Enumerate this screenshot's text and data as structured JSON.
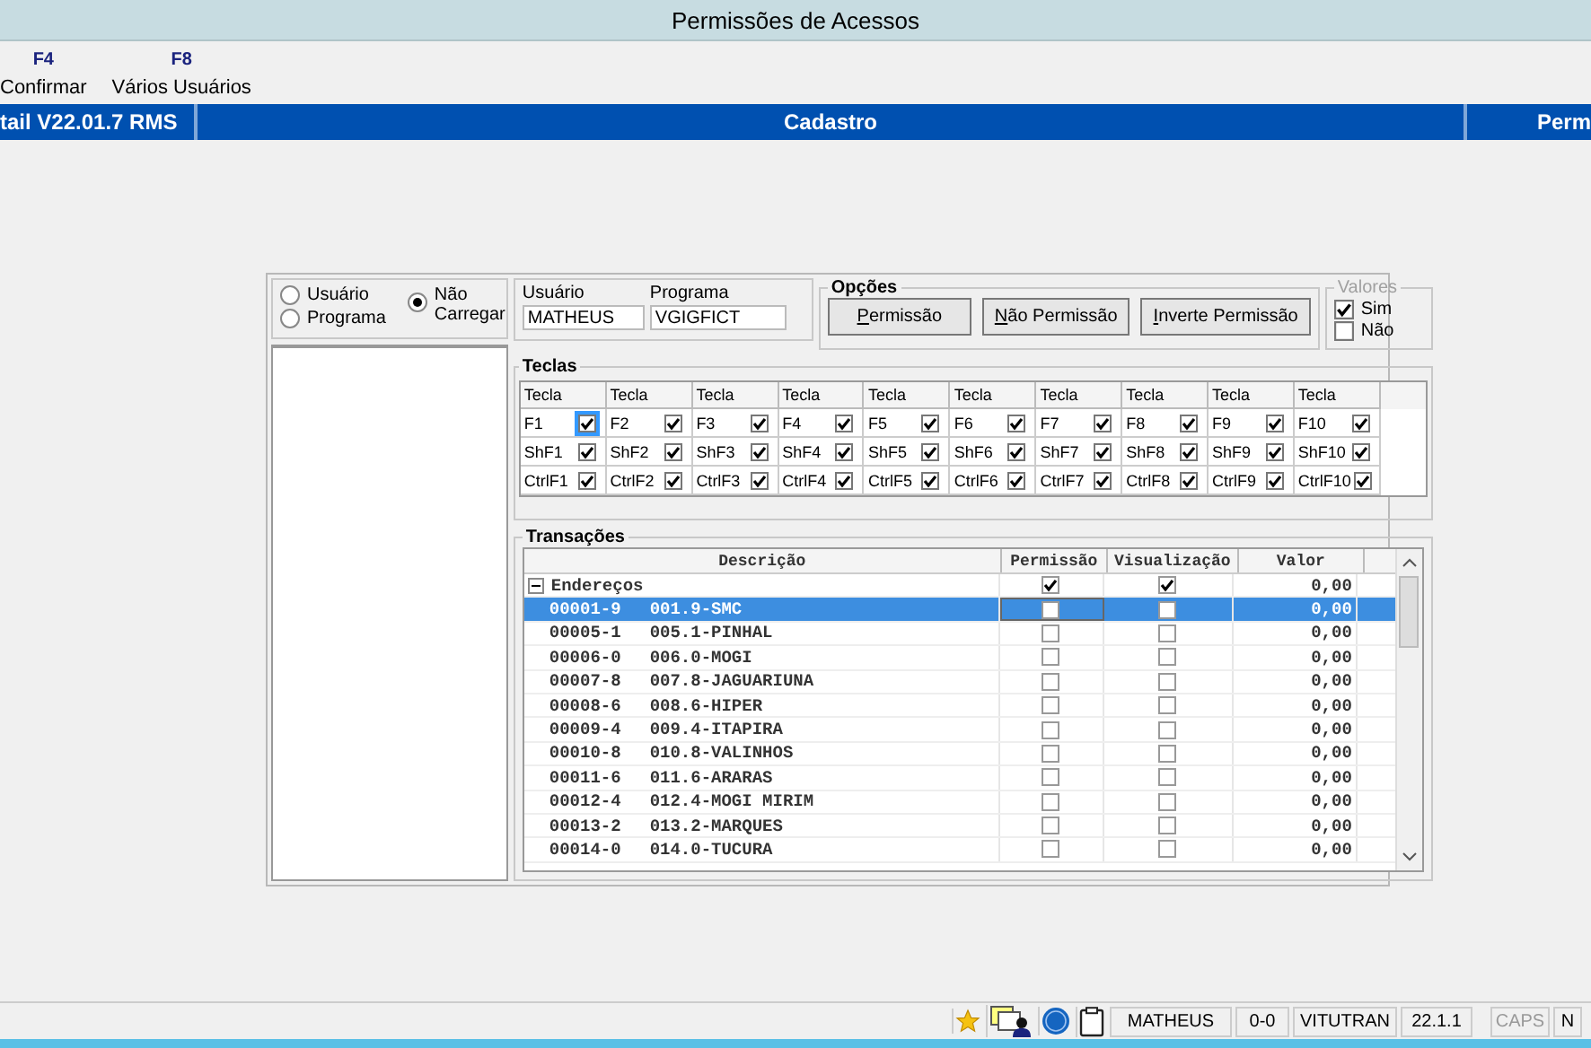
{
  "window": {
    "title": "Permissões de Acessos"
  },
  "toolbar": [
    {
      "key": "F4",
      "label": "Confirmar"
    },
    {
      "key": "F8",
      "label": "Vários Usuários"
    }
  ],
  "header_bar": {
    "left": "tail V22.01.7 RMS",
    "center": "Cadastro",
    "right": "Perm"
  },
  "mode": {
    "options": [
      {
        "label": "Usuário",
        "selected": false
      },
      {
        "label": "Programa",
        "selected": false
      },
      {
        "label": "Não Carregar",
        "selected": true
      }
    ]
  },
  "fields": [
    {
      "label": "Usuário",
      "value": "MATHEUS"
    },
    {
      "label": "Programa",
      "value": "VGIGFICT"
    }
  ],
  "opcoes": {
    "title": "Opções",
    "buttons": [
      "Permissão",
      "Não Permissão",
      "Inverte Permissão"
    ]
  },
  "valores": {
    "title": "Valores",
    "disabled": true,
    "options": [
      {
        "label": "Sim",
        "checked": true
      },
      {
        "label": "Não",
        "checked": false
      }
    ]
  },
  "teclas": {
    "title": "Teclas",
    "headers": [
      "Tecla",
      "Tecla",
      "Tecla",
      "Tecla",
      "Tecla",
      "Tecla",
      "Tecla",
      "Tecla",
      "Tecla",
      "Tecla"
    ],
    "rows": [
      {
        "keys": [
          {
            "label": "F1",
            "checked": true,
            "focused": true
          },
          {
            "label": "F2",
            "checked": true,
            "focused": false
          },
          {
            "label": "F3",
            "checked": true,
            "focused": false
          },
          {
            "label": "F4",
            "checked": true,
            "focused": false
          },
          {
            "label": "F5",
            "checked": true,
            "focused": false
          },
          {
            "label": "F6",
            "checked": true,
            "focused": false
          },
          {
            "label": "F7",
            "checked": true,
            "focused": false
          },
          {
            "label": "F8",
            "checked": true,
            "focused": false
          },
          {
            "label": "F9",
            "checked": true,
            "focused": false
          },
          {
            "label": "F10",
            "checked": true,
            "focused": false
          }
        ]
      },
      {
        "keys": [
          {
            "label": "ShF1",
            "checked": true,
            "focused": false
          },
          {
            "label": "ShF2",
            "checked": true,
            "focused": false
          },
          {
            "label": "ShF3",
            "checked": true,
            "focused": false
          },
          {
            "label": "ShF4",
            "checked": true,
            "focused": false
          },
          {
            "label": "ShF5",
            "checked": true,
            "focused": false
          },
          {
            "label": "ShF6",
            "checked": true,
            "focused": false
          },
          {
            "label": "ShF7",
            "checked": true,
            "focused": false
          },
          {
            "label": "ShF8",
            "checked": true,
            "focused": false
          },
          {
            "label": "ShF9",
            "checked": true,
            "focused": false
          },
          {
            "label": "ShF10",
            "checked": true,
            "focused": false
          }
        ]
      },
      {
        "keys": [
          {
            "label": "CtrlF1",
            "checked": true,
            "focused": false
          },
          {
            "label": "CtrlF2",
            "checked": true,
            "focused": false
          },
          {
            "label": "CtrlF3",
            "checked": true,
            "focused": false
          },
          {
            "label": "CtrlF4",
            "checked": true,
            "focused": false
          },
          {
            "label": "CtrlF5",
            "checked": true,
            "focused": false
          },
          {
            "label": "CtrlF6",
            "checked": true,
            "focused": false
          },
          {
            "label": "CtrlF7",
            "checked": true,
            "focused": false
          },
          {
            "label": "CtrlF8",
            "checked": true,
            "focused": false
          },
          {
            "label": "CtrlF9",
            "checked": true,
            "focused": false
          },
          {
            "label": "CtrlF10",
            "checked": true,
            "focused": false
          }
        ]
      }
    ]
  },
  "transacoes": {
    "title": "Transações",
    "columns": [
      "Descrição",
      "Permissão",
      "Visualização",
      "Valor"
    ],
    "rows": [
      {
        "description": "Endereços",
        "permissao": true,
        "visualizacao": true,
        "valor": "0,00",
        "expanded": true,
        "selected": false,
        "children": [
          {
            "code": "00001-9",
            "name": "001.9-SMC",
            "permissao": false,
            "visualizacao": false,
            "valor": "0,00",
            "selected": true
          },
          {
            "code": "00005-1",
            "name": "005.1-PINHAL",
            "permissao": false,
            "visualizacao": false,
            "valor": "0,00",
            "selected": false
          },
          {
            "code": "00006-0",
            "name": "006.0-MOGI",
            "permissao": false,
            "visualizacao": false,
            "valor": "0,00",
            "selected": false
          },
          {
            "code": "00007-8",
            "name": "007.8-JAGUARIUNA",
            "permissao": false,
            "visualizacao": false,
            "valor": "0,00",
            "selected": false
          },
          {
            "code": "00008-6",
            "name": "008.6-HIPER",
            "permissao": false,
            "visualizacao": false,
            "valor": "0,00",
            "selected": false
          },
          {
            "code": "00009-4",
            "name": "009.4-ITAPIRA",
            "permissao": false,
            "visualizacao": false,
            "valor": "0,00",
            "selected": false
          },
          {
            "code": "00010-8",
            "name": "010.8-VALINHOS",
            "permissao": false,
            "visualizacao": false,
            "valor": "0,00",
            "selected": false
          },
          {
            "code": "00011-6",
            "name": "011.6-ARARAS",
            "permissao": false,
            "visualizacao": false,
            "valor": "0,00",
            "selected": false
          },
          {
            "code": "00012-4",
            "name": "012.4-MOGI MIRIM",
            "permissao": false,
            "visualizacao": false,
            "valor": "0,00",
            "selected": false
          },
          {
            "code": "00013-2",
            "name": "013.2-MARQUES",
            "permissao": false,
            "visualizacao": false,
            "valor": "0,00",
            "selected": false
          },
          {
            "code": "00014-0",
            "name": "014.0-TUCURA",
            "permissao": false,
            "visualizacao": false,
            "valor": "0,00",
            "selected": false
          }
        ]
      }
    ]
  },
  "status_bar": {
    "fields": [
      {
        "text": "MATHEUS",
        "disabled": false
      },
      {
        "text": "0-0",
        "disabled": false
      },
      {
        "text": "VITUTRAN",
        "disabled": false
      },
      {
        "text": "22.1.1",
        "disabled": false
      },
      {
        "text": "CAPS",
        "disabled": true
      },
      {
        "text": "N",
        "disabled": false
      }
    ]
  }
}
